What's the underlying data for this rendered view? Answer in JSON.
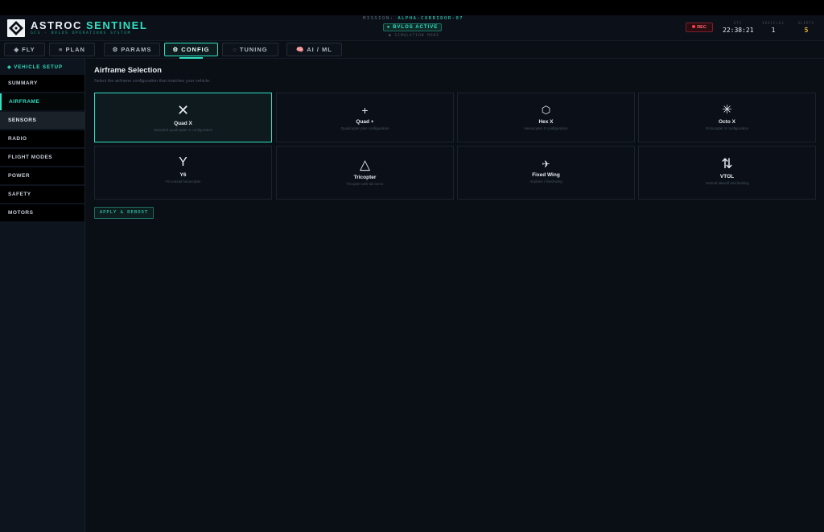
{
  "header": {
    "brand_main": "ASTROC",
    "brand_accent": "SENTINEL",
    "brand_sub": "GCS · BVLOS OPERATIONS SYSTEM",
    "mission_label": "MISSION:",
    "mission_value": "ALPHA-CORRIDOR-07",
    "bvlos_badge": "● BVLOS ACTIVE",
    "sim_mode": "● SIMULATION MODE",
    "rec_label": "REC",
    "utc_label": "UTC",
    "utc_value": "22:38:21",
    "vehicles_label": "VEHICLES",
    "vehicles_value": "1",
    "alerts_label": "ALERTS",
    "alerts_value": "5"
  },
  "tabs": [
    {
      "label": "◈ FLY"
    },
    {
      "label": "≡ PLAN"
    },
    {
      "label": "⚙ PARAMS"
    },
    {
      "label": "⚙ CONFIG"
    },
    {
      "label": "◌ TUNING"
    },
    {
      "label": "🧠 AI / ML"
    }
  ],
  "sidebar": {
    "heading": "◈ VEHICLE SETUP",
    "items": [
      {
        "label": "SUMMARY"
      },
      {
        "label": "AIRFRAME"
      },
      {
        "label": "SENSORS"
      },
      {
        "label": "RADIO"
      },
      {
        "label": "FLIGHT MODES"
      },
      {
        "label": "POWER"
      },
      {
        "label": "SAFETY"
      },
      {
        "label": "MOTORS"
      }
    ]
  },
  "main": {
    "title": "Airframe Selection",
    "subtitle": "Select the airframe configuration that matches your vehicle.",
    "apply_label": "APPLY & REBOOT",
    "airframes": [
      {
        "icon": "✕",
        "name": "Quad X",
        "desc": "Standard quadcopter X configuration"
      },
      {
        "icon": "+",
        "name": "Quad +",
        "desc": "Quadcopter plus configuration"
      },
      {
        "icon": "⬡",
        "name": "Hex X",
        "desc": "Hexacopter X configuration"
      },
      {
        "icon": "✳",
        "name": "Octo X",
        "desc": "Octocopter X configuration"
      },
      {
        "icon": "Y",
        "name": "Y6",
        "desc": "Y6 coaxial hexacopter"
      },
      {
        "icon": "△",
        "name": "Tricopter",
        "desc": "Tricopter with tail servo"
      },
      {
        "icon": "✈",
        "name": "Fixed Wing",
        "desc": "Airplane / fixed-wing"
      },
      {
        "icon": "⇅",
        "name": "VTOL",
        "desc": "Vertical takeoff and landing"
      }
    ]
  },
  "colors": {
    "accent": "#2fe0c3",
    "warn": "#f2b632",
    "rec": "#ff3b48"
  }
}
